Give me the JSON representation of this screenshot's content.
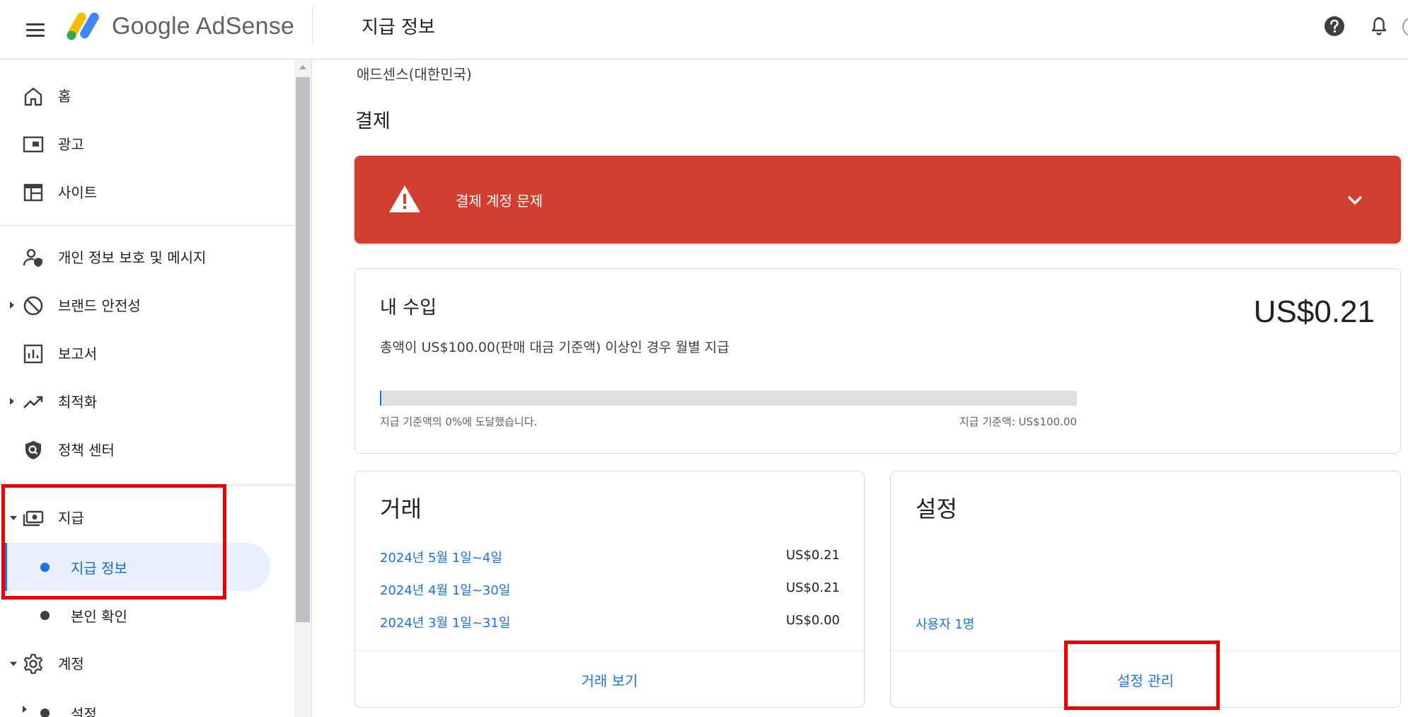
{
  "header": {
    "app_name": "Google AdSense",
    "page_title": "지급 정보"
  },
  "sidebar": {
    "items": [
      {
        "label": "홈",
        "icon": "home-icon"
      },
      {
        "label": "광고",
        "icon": "ads-icon"
      },
      {
        "label": "사이트",
        "icon": "sites-icon"
      },
      {
        "label": "개인 정보 보호 및 메시지",
        "icon": "privacy-icon"
      },
      {
        "label": "브랜드 안전성",
        "icon": "block-icon"
      },
      {
        "label": "보고서",
        "icon": "reports-icon"
      },
      {
        "label": "최적화",
        "icon": "trending-icon"
      },
      {
        "label": "정책 센터",
        "icon": "policy-shield-icon"
      },
      {
        "label": "지급",
        "icon": "payments-icon"
      },
      {
        "label": "계정",
        "icon": "gear-icon"
      }
    ],
    "payments_sub": [
      {
        "label": "지급 정보",
        "active": true
      },
      {
        "label": "본인 확인",
        "active": false
      }
    ],
    "account_sub": [
      {
        "label": "설정"
      }
    ]
  },
  "main": {
    "region": "애드센스(대한민국)",
    "section_title": "결제",
    "alert": {
      "text": "결제 계정 문제",
      "color": "#d23f31"
    },
    "earnings": {
      "title": "내 수입",
      "amount": "US$0.21",
      "description": "총액이 US$100.00(판매 대금 기준액) 이상인 경우 월별 지급",
      "progress_fraction": 0.0021,
      "progress_left": "지급 기준액의 0%에 도달했습니다.",
      "progress_right": "지급 기준액: US$100.00"
    },
    "transactions": {
      "title": "거래",
      "rows": [
        {
          "date": "2024년 5월 1일~4일",
          "amount": "US$0.21"
        },
        {
          "date": "2024년 4월 1일~30일",
          "amount": "US$0.21"
        },
        {
          "date": "2024년 3월 1일~31일",
          "amount": "US$0.00"
        }
      ],
      "footer_button": "거래 보기"
    },
    "settings": {
      "title": "설정",
      "users_link": "사용자 1명",
      "footer_button": "설정 관리"
    }
  },
  "colors": {
    "accent": "#1a73e8",
    "highlight": "#ee0000",
    "alert": "#d23f31"
  }
}
